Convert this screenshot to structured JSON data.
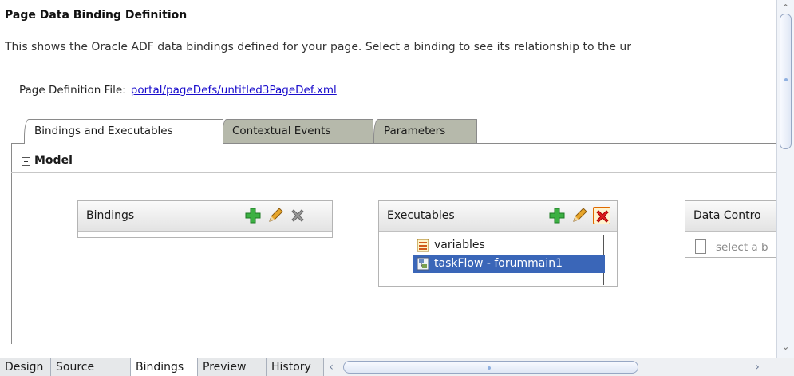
{
  "page": {
    "title": "Page Data Binding Definition",
    "description": "This shows the Oracle ADF data bindings defined for your page. Select a binding to see its relationship to the ur",
    "pagedef_label": "Page Definition File:",
    "pagedef_link": "portal/pageDefs/untitled3PageDef.xml"
  },
  "tabs": [
    "Bindings and Executables",
    "Contextual Events",
    "Parameters"
  ],
  "active_tab": "Bindings and Executables",
  "model": {
    "label": "Model"
  },
  "bindings_panel": {
    "title": "Bindings"
  },
  "executables_panel": {
    "title": "Executables",
    "items": [
      {
        "label": "variables",
        "icon": "variables-icon",
        "selected": false
      },
      {
        "label": "taskFlow - forummain1",
        "icon": "taskflow-icon",
        "selected": true
      }
    ]
  },
  "data_controls_panel": {
    "title": "Data Contro",
    "hint": "select a b"
  },
  "bottom_tabs": [
    "Design",
    "Source",
    "Bindings",
    "Preview",
    "History"
  ],
  "active_bottom_tab": "Bindings",
  "colors": {
    "selection": "#3a66b8",
    "link": "#1a0dcc",
    "add": "#3cb043",
    "delete": "#d22",
    "edit": "#e0a020"
  }
}
